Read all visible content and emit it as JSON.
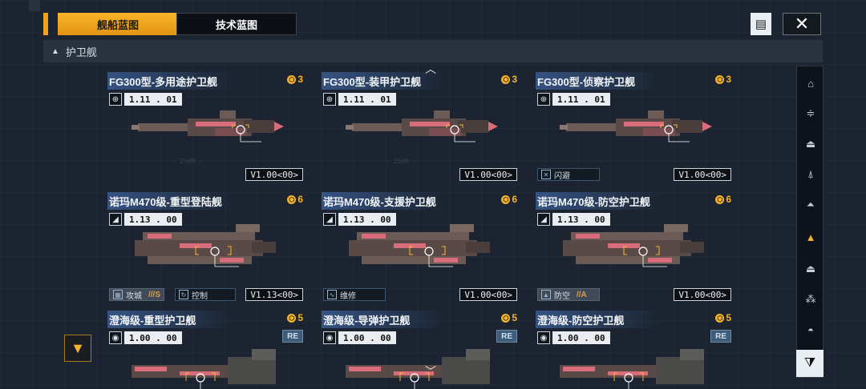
{
  "tabs": {
    "ship_blueprint": "舰船蓝图",
    "tech_blueprint": "技术蓝图"
  },
  "toolbar": {
    "list_icon": "list-icon",
    "close_icon": "close-icon"
  },
  "section": {
    "label": "护卫舰",
    "collapse_icon": "▲"
  },
  "cards": [
    {
      "title": "FG300型-多用途护卫舰",
      "cost": "3",
      "version": "1.11 . 01",
      "badge": "V1.00<00>",
      "class_icon": "globe-icon"
    },
    {
      "title": "FG300型-装甲护卫舰",
      "cost": "3",
      "version": "1.11 . 01",
      "badge": "V1.00<00>",
      "class_icon": "globe-icon"
    },
    {
      "title": "FG300型-侦察护卫舰",
      "cost": "3",
      "version": "1.11 . 01",
      "badge": "V1.00<00>",
      "class_icon": "globe-icon",
      "role1": "闪避"
    },
    {
      "title": "诺玛M470级-重型登陆舰",
      "cost": "6",
      "version": "1.13 . 00",
      "badge": "V1.13<00>",
      "class_icon": "emblem-icon",
      "role1": "攻城",
      "role1_grade": "///S",
      "role2": "控制"
    },
    {
      "title": "诺玛M470级-支援护卫舰",
      "cost": "6",
      "version": "1.13 . 00",
      "badge": "V1.00<00>",
      "class_icon": "emblem-icon",
      "role1": "维修"
    },
    {
      "title": "诺玛M470级-防空护卫舰",
      "cost": "6",
      "version": "1.13 . 00",
      "badge": "V1.00<00>",
      "class_icon": "emblem-icon",
      "role1": "防空",
      "role1_grade": "//A"
    },
    {
      "title": "澄海级-重型护卫舰",
      "cost": "5",
      "version": "1.00 . 00",
      "re": "RE",
      "class_icon": "emblem-round-icon"
    },
    {
      "title": "澄海级-导弹护卫舰",
      "cost": "5",
      "version": "1.00 . 00",
      "re": "RE",
      "class_icon": "emblem-round-icon"
    },
    {
      "title": "澄海级-防空护卫舰",
      "cost": "5",
      "version": "1.00 . 00",
      "re": "RE",
      "class_icon": "emblem-round-icon"
    }
  ],
  "filters": [
    "flagship-icon",
    "carrier-icon",
    "battlecruiser-icon",
    "cruiser-icon",
    "destroyer-icon",
    "frigate-icon",
    "corvette-icon",
    "fighter-squad-icon",
    "aux-icon"
  ],
  "filter_active_index": 5,
  "colors": {
    "accent": "#f4b52c",
    "tab_active": "#f0a21c",
    "background": "#1b2430"
  }
}
